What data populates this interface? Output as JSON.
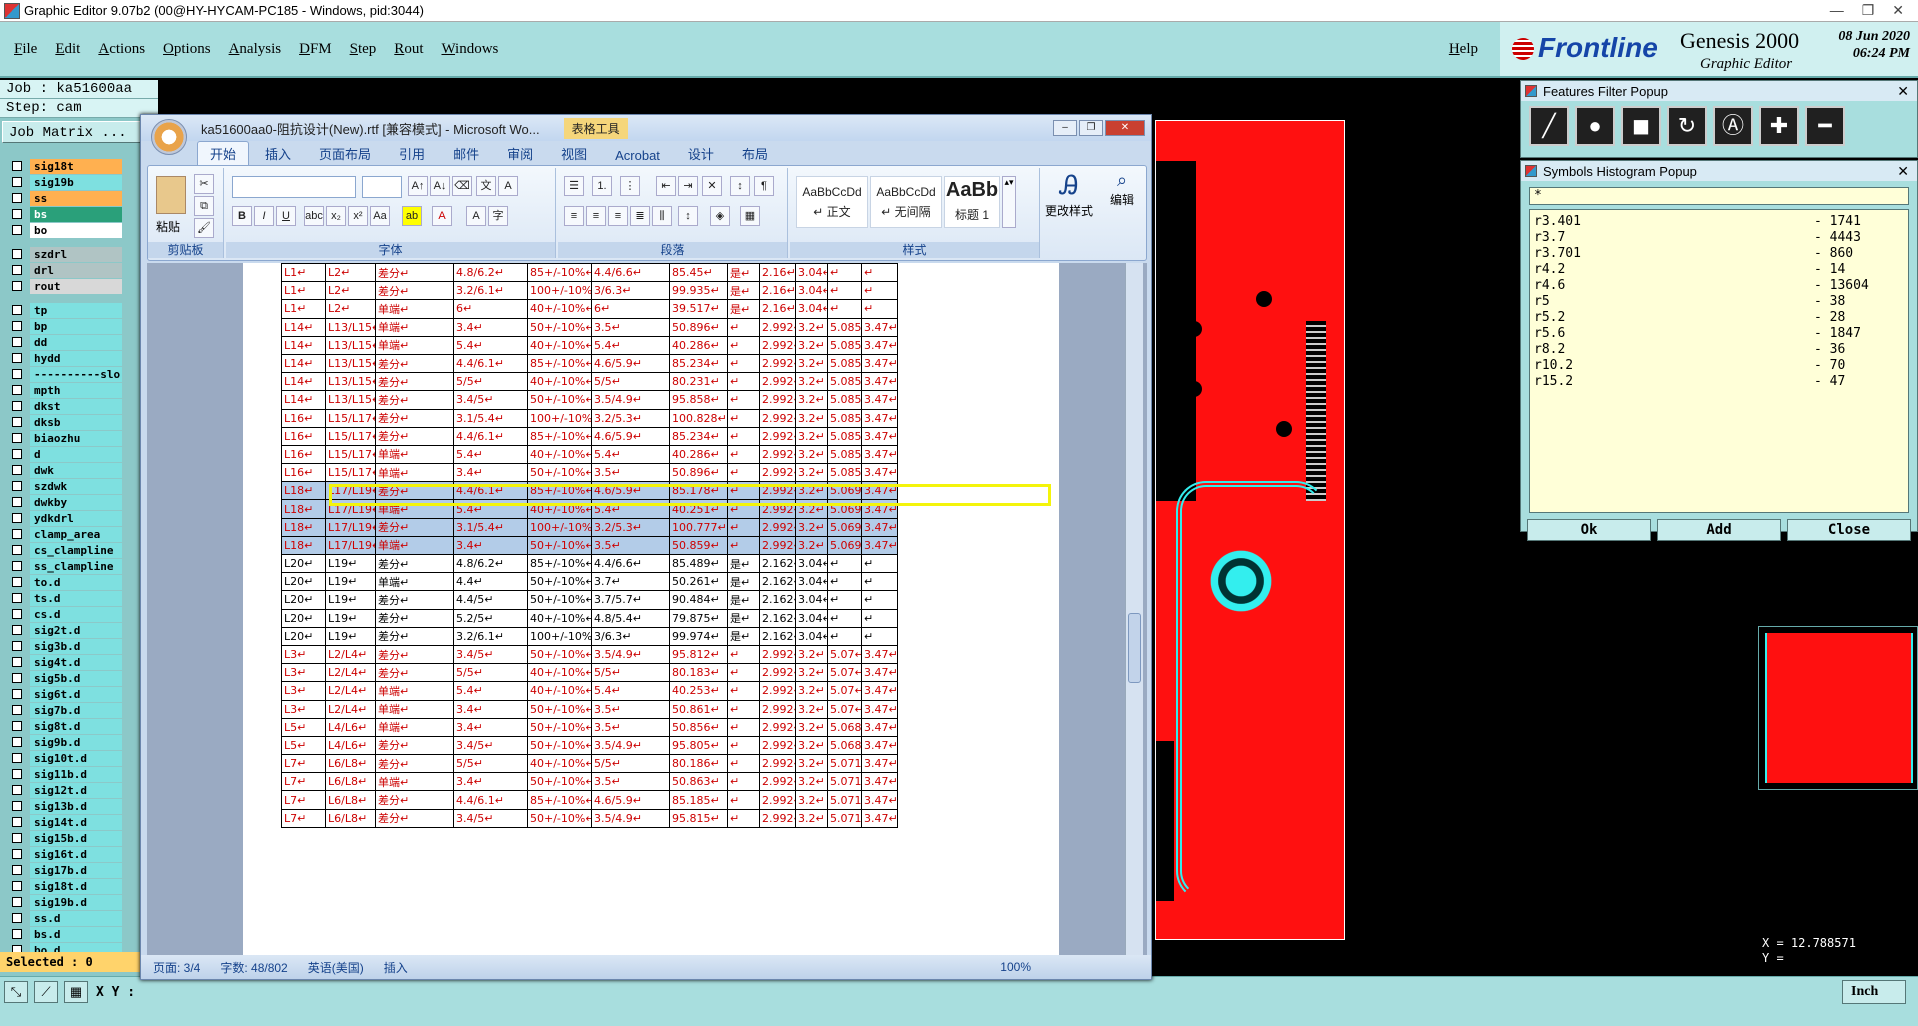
{
  "window_title": "Graphic Editor 9.07b2 (00@HY-HYCAM-PC185 - Windows, pid:3044)",
  "menu": [
    "File",
    "Edit",
    "Actions",
    "Options",
    "Analysis",
    "DFM",
    "Step",
    "Rout",
    "Windows"
  ],
  "help": "Help",
  "brand": {
    "logo": "Frontline",
    "product": "Genesis 2000",
    "subtitle": "Graphic Editor",
    "date": "08 Jun 2020",
    "time": "06:24 PM"
  },
  "job": "Job : ka51600aa",
  "step": "Step: cam",
  "job_matrix": "Job Matrix ...",
  "layers": [
    {
      "name": "sig18t",
      "color": "#ffb050",
      "mark": "#e00"
    },
    {
      "name": "sig19b",
      "color": "#7ee0e0"
    },
    {
      "name": "ss",
      "color": "#ffb050"
    },
    {
      "name": "bs",
      "color": "#2aa07a"
    },
    {
      "name": "bo",
      "color": "#ffffff"
    },
    {
      "name": "szdrl",
      "color": "#b0c4c4",
      "gap": true
    },
    {
      "name": "drl",
      "color": "#b0c4c4"
    },
    {
      "name": "rout",
      "color": "#d8d8d8"
    },
    {
      "name": "tp",
      "color": "#7ee0e0",
      "gap": true
    },
    {
      "name": "bp",
      "color": "#7ee0e0"
    },
    {
      "name": "dd",
      "color": "#7ee0e0"
    },
    {
      "name": "hydd",
      "color": "#7ee0e0"
    },
    {
      "name": "----------slo",
      "color": "#7ee0e0"
    },
    {
      "name": "mpth",
      "color": "#7ee0e0"
    },
    {
      "name": "dkst",
      "color": "#7ee0e0"
    },
    {
      "name": "dksb",
      "color": "#7ee0e0"
    },
    {
      "name": "biaozhu",
      "color": "#7ee0e0"
    },
    {
      "name": "d",
      "color": "#7ee0e0"
    },
    {
      "name": "dwk",
      "color": "#7ee0e0"
    },
    {
      "name": "szdwk",
      "color": "#7ee0e0"
    },
    {
      "name": "dwkby",
      "color": "#7ee0e0"
    },
    {
      "name": "ydkdrl",
      "color": "#7ee0e0"
    },
    {
      "name": "clamp_area",
      "color": "#7ee0e0"
    },
    {
      "name": "cs_clampline",
      "color": "#7ee0e0"
    },
    {
      "name": "ss_clampline",
      "color": "#7ee0e0"
    },
    {
      "name": "to.d",
      "color": "#7ee0e0"
    },
    {
      "name": "ts.d",
      "color": "#7ee0e0"
    },
    {
      "name": "cs.d",
      "color": "#7ee0e0"
    },
    {
      "name": "sig2t.d",
      "color": "#7ee0e0"
    },
    {
      "name": "sig3b.d",
      "color": "#7ee0e0"
    },
    {
      "name": "sig4t.d",
      "color": "#7ee0e0"
    },
    {
      "name": "sig5b.d",
      "color": "#7ee0e0"
    },
    {
      "name": "sig6t.d",
      "color": "#7ee0e0"
    },
    {
      "name": "sig7b.d",
      "color": "#7ee0e0"
    },
    {
      "name": "sig8t.d",
      "color": "#7ee0e0"
    },
    {
      "name": "sig9b.d",
      "color": "#7ee0e0"
    },
    {
      "name": "sig10t.d",
      "color": "#7ee0e0"
    },
    {
      "name": "sig11b.d",
      "color": "#7ee0e0"
    },
    {
      "name": "sig12t.d",
      "color": "#7ee0e0"
    },
    {
      "name": "sig13b.d",
      "color": "#7ee0e0"
    },
    {
      "name": "sig14t.d",
      "color": "#7ee0e0"
    },
    {
      "name": "sig15b.d",
      "color": "#7ee0e0"
    },
    {
      "name": "sig16t.d",
      "color": "#7ee0e0"
    },
    {
      "name": "sig17b.d",
      "color": "#7ee0e0"
    },
    {
      "name": "sig18t.d",
      "color": "#7ee0e0"
    },
    {
      "name": "sig19b.d",
      "color": "#7ee0e0"
    },
    {
      "name": "ss.d",
      "color": "#7ee0e0"
    },
    {
      "name": "bs.d",
      "color": "#7ee0e0"
    },
    {
      "name": "bo.d",
      "color": "#7ee0e0"
    }
  ],
  "selected": "Selected : 0",
  "xy_label": "X Y :",
  "unit": "Inch",
  "coords": {
    "x": "X = 12.788571",
    "y": "Y ="
  },
  "ffp": {
    "title": "Features Filter Popup",
    "tools": [
      "line-tool",
      "pad-tool",
      "surface-tool",
      "arc-tool",
      "text-tool",
      "add-tool",
      "remove-tool"
    ]
  },
  "shp": {
    "title": "Symbols Histogram Popup",
    "filter": "*",
    "rows": [
      [
        "r3.401",
        "- 1741"
      ],
      [
        "r3.7",
        "- 4443"
      ],
      [
        "r3.701",
        "- 860"
      ],
      [
        "r4.2",
        "- 14"
      ],
      [
        "r4.6",
        "- 13604"
      ],
      [
        "r5",
        "- 38"
      ],
      [
        "r5.2",
        "- 28"
      ],
      [
        "r5.6",
        "- 1847"
      ],
      [
        "r8.2",
        "- 36"
      ],
      [
        "r10.2",
        "- 70"
      ],
      [
        "r15.2",
        "- 47"
      ]
    ],
    "ok": "Ok",
    "add": "Add",
    "close": "Close"
  },
  "word": {
    "title": "ka51600aa0-阻抗设计(New).rtf [兼容模式] - Microsoft Wo...",
    "tool_tab": "表格工具",
    "tabs": [
      "开始",
      "插入",
      "页面布局",
      "引用",
      "邮件",
      "审阅",
      "视图",
      "Acrobat",
      "设计",
      "布局"
    ],
    "groups": {
      "clipboard": "剪贴板",
      "font": "字体",
      "paragraph": "段落",
      "styles": "样式",
      "edit": "编辑"
    },
    "paste": "粘贴",
    "styles": [
      {
        "preview": "AaBbCcDd",
        "label": "↵ 正文"
      },
      {
        "preview": "AaBbCcDd",
        "label": "↵ 无间隔"
      },
      {
        "preview": "AaBb",
        "label": "标题 1"
      }
    ],
    "change_style": "更改样式",
    "edit_btn": "编辑",
    "status": {
      "page": "页面: 3/4",
      "words": "字数: 48/802",
      "lang": "英语(美国)",
      "mode": "插入",
      "zoom": "100%"
    },
    "table": [
      {
        "c": "red",
        "cells": [
          "L1↵",
          "L2↵",
          "差分↵",
          "4.8/6.2↵",
          "85+/-10%↵",
          "4.4/6.6↵",
          "85.45↵",
          "是↵",
          "2.16↵",
          "3.04↵",
          "↵",
          "↵"
        ]
      },
      {
        "c": "red",
        "cells": [
          "L1↵",
          "L2↵",
          "差分↵",
          "3.2/6.1↵",
          "100+/-10%↵",
          "3/6.3↵",
          "99.935↵",
          "是↵",
          "2.16↵",
          "3.04↵",
          "↵",
          "↵"
        ]
      },
      {
        "c": "red",
        "cells": [
          "L1↵",
          "L2↵",
          "单端↵",
          "6↵",
          "40+/-10%↵",
          "6↵",
          "39.517↵",
          "是↵",
          "2.16↵",
          "3.04↵",
          "↵",
          "↵"
        ]
      },
      {
        "c": "red",
        "cells": [
          "L14↵",
          "L13/L15↵",
          "单端↵",
          "3.4↵",
          "50+/-10%↵",
          "3.5↵",
          "50.896↵",
          "↵",
          "2.992↵",
          "3.2↵",
          "5.085↵",
          "3.47↵"
        ]
      },
      {
        "c": "red",
        "cells": [
          "L14↵",
          "L13/L15↵",
          "单端↵",
          "5.4↵",
          "40+/-10%↵",
          "5.4↵",
          "40.286↵",
          "↵",
          "2.992↵",
          "3.2↵",
          "5.085↵",
          "3.47↵"
        ]
      },
      {
        "c": "red",
        "cells": [
          "L14↵",
          "L13/L15↵",
          "差分↵",
          "4.4/6.1↵",
          "85+/-10%↵",
          "4.6/5.9↵",
          "85.234↵",
          "↵",
          "2.992↵",
          "3.2↵",
          "5.085↵",
          "3.47↵"
        ]
      },
      {
        "c": "red",
        "cells": [
          "L14↵",
          "L13/L15↵",
          "差分↵",
          "5/5↵",
          "40+/-10%↵",
          "5/5↵",
          "80.231↵",
          "↵",
          "2.992↵",
          "3.2↵",
          "5.085↵",
          "3.47↵"
        ]
      },
      {
        "c": "red",
        "cells": [
          "L14↵",
          "L13/L15↵",
          "差分↵",
          "3.4/5↵",
          "50+/-10%↵",
          "3.5/4.9↵",
          "95.858↵",
          "↵",
          "2.992↵",
          "3.2↵",
          "5.085↵",
          "3.47↵"
        ]
      },
      {
        "c": "red",
        "cells": [
          "L16↵",
          "L15/L17↵",
          "差分↵",
          "3.1/5.4↵",
          "100+/-10%↵",
          "3.2/5.3↵",
          "100.828↵",
          "↵",
          "2.992↵",
          "3.2↵",
          "5.085↵",
          "3.47↵"
        ]
      },
      {
        "c": "red",
        "cells": [
          "L16↵",
          "L15/L17↵",
          "差分↵",
          "4.4/6.1↵",
          "85+/-10%↵",
          "4.6/5.9↵",
          "85.234↵",
          "↵",
          "2.992↵",
          "3.2↵",
          "5.085↵",
          "3.47↵"
        ]
      },
      {
        "c": "red",
        "cells": [
          "L16↵",
          "L15/L17↵",
          "单端↵",
          "5.4↵",
          "40+/-10%↵",
          "5.4↵",
          "40.286↵",
          "↵",
          "2.992↵",
          "3.2↵",
          "5.085↵",
          "3.47↵"
        ]
      },
      {
        "c": "red",
        "cells": [
          "L16↵",
          "L15/L17↵",
          "单端↵",
          "3.4↵",
          "50+/-10%↵",
          "3.5↵",
          "50.896↵",
          "↵",
          "2.992↵",
          "3.2↵",
          "5.085↵",
          "3.47↵"
        ]
      },
      {
        "c": "red sel",
        "cells": [
          "L18↵",
          "L17/L19↵",
          "差分↵",
          "4.4/6.1↵",
          "85+/-10%↵",
          "4.6/5.9↵",
          "85.178↵",
          "↵",
          "2.992↵",
          "3.2↵",
          "5.069↵",
          "3.47↵"
        ]
      },
      {
        "c": "red sel",
        "cells": [
          "L18↵",
          "L17/L19↵",
          "单端↵",
          "5.4↵",
          "40+/-10%↵",
          "5.4↵",
          "40.251↵",
          "↵",
          "2.992↵",
          "3.2↵",
          "5.069↵",
          "3.47↵"
        ]
      },
      {
        "c": "red sel",
        "cells": [
          "L18↵",
          "L17/L19↵",
          "差分↵",
          "3.1/5.4↵",
          "100+/-10%↵",
          "3.2/5.3↵",
          "100.777↵",
          "↵",
          "2.992↵",
          "3.2↵",
          "5.069↵",
          "3.47↵"
        ]
      },
      {
        "c": "red sel",
        "cells": [
          "L18↵",
          "L17/L19↵",
          "单端↵",
          "3.4↵",
          "50+/-10%↵",
          "3.5↵",
          "50.859↵",
          "↵",
          "2.992↵",
          "3.2↵",
          "5.069↵",
          "3.47↵"
        ]
      },
      {
        "c": "blk",
        "cells": [
          "L20↵",
          "L19↵",
          "差分↵",
          "4.8/6.2↵",
          "85+/-10%↵",
          "4.4/6.6↵",
          "85.489↵",
          "是↵",
          "2.162↵",
          "3.04↵",
          "↵",
          "↵"
        ]
      },
      {
        "c": "blk",
        "cells": [
          "L20↵",
          "L19↵",
          "单端↵",
          "4.4↵",
          "50+/-10%↵",
          "3.7↵",
          "50.261↵",
          "是↵",
          "2.162↵",
          "3.04↵",
          "↵",
          "↵"
        ]
      },
      {
        "c": "blk",
        "cells": [
          "L20↵",
          "L19↵",
          "差分↵",
          "4.4/5↵",
          "50+/-10%↵",
          "3.7/5.7↵",
          "90.484↵",
          "是↵",
          "2.162↵",
          "3.04↵",
          "↵",
          "↵"
        ]
      },
      {
        "c": "blk",
        "cells": [
          "L20↵",
          "L19↵",
          "差分↵",
          "5.2/5↵",
          "40+/-10%↵",
          "4.8/5.4↵",
          "79.875↵",
          "是↵",
          "2.162↵",
          "3.04↵",
          "↵",
          "↵"
        ]
      },
      {
        "c": "blk",
        "cells": [
          "L20↵",
          "L19↵",
          "差分↵",
          "3.2/6.1↵",
          "100+/-10%↵",
          "3/6.3↵",
          "99.974↵",
          "是↵",
          "2.162↵",
          "3.04↵",
          "↵",
          "↵"
        ]
      },
      {
        "c": "red",
        "cells": [
          "L3↵",
          "L2/L4↵",
          "差分↵",
          "3.4/5↵",
          "50+/-10%↵",
          "3.5/4.9↵",
          "95.812↵",
          "↵",
          "2.992↵",
          "3.2↵",
          "5.07↵",
          "3.47↵"
        ]
      },
      {
        "c": "red",
        "cells": [
          "L3↵",
          "L2/L4↵",
          "差分↵",
          "5/5↵",
          "40+/-10%↵",
          "5/5↵",
          "80.183↵",
          "↵",
          "2.992↵",
          "3.2↵",
          "5.07↵",
          "3.47↵"
        ]
      },
      {
        "c": "red",
        "cells": [
          "L3↵",
          "L2/L4↵",
          "单端↵",
          "5.4↵",
          "40+/-10%↵",
          "5.4↵",
          "40.253↵",
          "↵",
          "2.992↵",
          "3.2↵",
          "5.07↵",
          "3.47↵"
        ]
      },
      {
        "c": "red",
        "cells": [
          "L3↵",
          "L2/L4↵",
          "单端↵",
          "3.4↵",
          "50+/-10%↵",
          "3.5↵",
          "50.861↵",
          "↵",
          "2.992↵",
          "3.2↵",
          "5.07↵",
          "3.47↵"
        ]
      },
      {
        "c": "red",
        "cells": [
          "L5↵",
          "L4/L6↵",
          "单端↵",
          "3.4↵",
          "50+/-10%↵",
          "3.5↵",
          "50.856↵",
          "↵",
          "2.992↵",
          "3.2↵",
          "5.068↵",
          "3.47↵"
        ]
      },
      {
        "c": "red",
        "cells": [
          "L5↵",
          "L4/L6↵",
          "差分↵",
          "3.4/5↵",
          "50+/-10%↵",
          "3.5/4.9↵",
          "95.805↵",
          "↵",
          "2.992↵",
          "3.2↵",
          "5.068↵",
          "3.47↵"
        ]
      },
      {
        "c": "red",
        "cells": [
          "L7↵",
          "L6/L8↵",
          "差分↵",
          "5/5↵",
          "40+/-10%↵",
          "5/5↵",
          "80.186↵",
          "↵",
          "2.992↵",
          "3.2↵",
          "5.071↵",
          "3.47↵"
        ]
      },
      {
        "c": "red",
        "cells": [
          "L7↵",
          "L6/L8↵",
          "单端↵",
          "3.4↵",
          "50+/-10%↵",
          "3.5↵",
          "50.863↵",
          "↵",
          "2.992↵",
          "3.2↵",
          "5.071↵",
          "3.47↵"
        ]
      },
      {
        "c": "red",
        "cells": [
          "L7↵",
          "L6/L8↵",
          "差分↵",
          "4.4/6.1↵",
          "85+/-10%↵",
          "4.6/5.9↵",
          "85.185↵",
          "↵",
          "2.992↵",
          "3.2↵",
          "5.071↵",
          "3.47↵"
        ]
      },
      {
        "c": "red",
        "cells": [
          "L7↵",
          "L6/L8↵",
          "差分↵",
          "3.4/5↵",
          "50+/-10%↵",
          "3.5/4.9↵",
          "95.815↵",
          "↵",
          "2.992↵",
          "3.2↵",
          "5.071↵",
          "3.47↵"
        ]
      }
    ]
  }
}
